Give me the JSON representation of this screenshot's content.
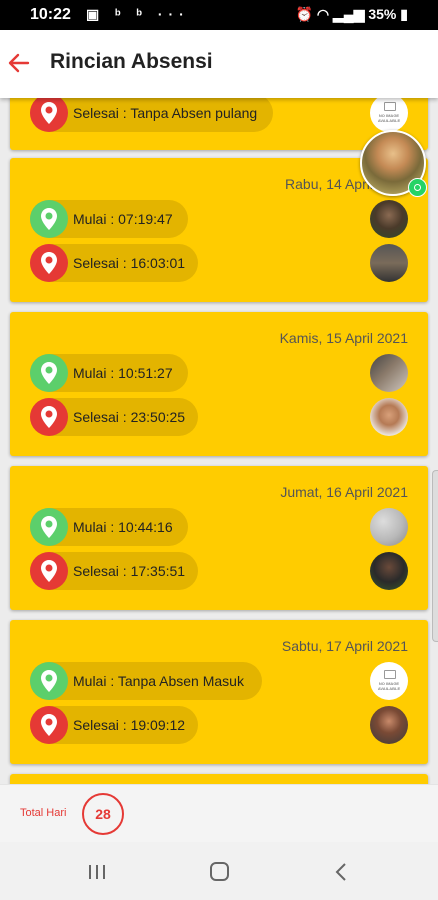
{
  "status_bar": {
    "time": "10:22",
    "battery": "35%"
  },
  "header": {
    "title": "Rincian Absensi"
  },
  "cards": [
    {
      "date": "",
      "entries": [
        {
          "type": "end",
          "text": "Selesai : Tanpa Absen pulang",
          "photo": "no-image"
        }
      ]
    },
    {
      "date": "Rabu, 14 April 2021",
      "entries": [
        {
          "type": "start",
          "text": "Mulai : 07:19:47",
          "photo": "photo"
        },
        {
          "type": "end",
          "text": "Selesai : 16:03:01",
          "photo": "photo"
        }
      ]
    },
    {
      "date": "Kamis, 15 April 2021",
      "entries": [
        {
          "type": "start",
          "text": "Mulai : 10:51:27",
          "photo": "photo"
        },
        {
          "type": "end",
          "text": "Selesai : 23:50:25",
          "photo": "photo"
        }
      ]
    },
    {
      "date": "Jumat, 16 April 2021",
      "entries": [
        {
          "type": "start",
          "text": "Mulai : 10:44:16",
          "photo": "photo"
        },
        {
          "type": "end",
          "text": "Selesai : 17:35:51",
          "photo": "photo"
        }
      ]
    },
    {
      "date": "Sabtu, 17 April 2021",
      "entries": [
        {
          "type": "start",
          "text": "Mulai : Tanpa Absen Masuk",
          "photo": "no-image"
        },
        {
          "type": "end",
          "text": "Selesai : 19:09:12",
          "photo": "photo"
        }
      ]
    }
  ],
  "no_image_text": "NO IMAGE AVAILABLE",
  "footer": {
    "total_label": "Total Hari",
    "total_value": "28"
  },
  "colors": {
    "card": "#ffcc00",
    "pill": "#e3b400",
    "start_pin": "#5ccf6b",
    "end_pin": "#e53935",
    "accent": "#e53935"
  }
}
